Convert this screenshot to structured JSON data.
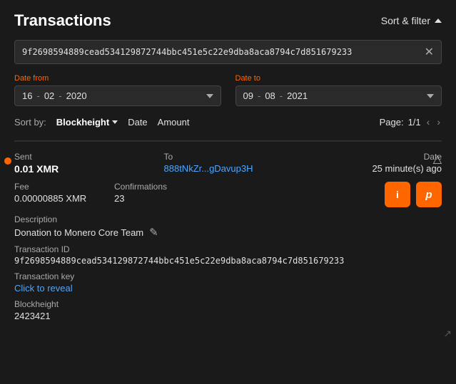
{
  "header": {
    "title": "Transactions",
    "sort_filter_label": "Sort & filter"
  },
  "search": {
    "value": "9f2698594889cead534129872744bbc451e5c22e9dba8aca8794c7d851679233"
  },
  "date_from": {
    "label": "Date from",
    "day": "16",
    "sep1": "-",
    "month": "02",
    "sep2": "-",
    "year": "2020"
  },
  "date_to": {
    "label": "Date to",
    "day": "09",
    "sep1": "-",
    "month": "08",
    "sep2": "-",
    "year": "2021"
  },
  "sort_row": {
    "label": "Sort by:",
    "blockheight": "Blockheight",
    "date": "Date",
    "amount": "Amount",
    "page_label": "Page:",
    "page_value": "1/1"
  },
  "transaction": {
    "sent_label": "Sent",
    "sent_amount": "0.01 XMR",
    "to_label": "To",
    "to_address": "888tNkZr...gDavup3H",
    "date_label": "Date",
    "date_value": "25 minute(s) ago",
    "fee_label": "Fee",
    "fee_value": "0.00000885 XMR",
    "confirmations_label": "Confirmations",
    "confirmations_value": "23",
    "description_label": "Description",
    "description_value": "Donation to Monero Core Team",
    "txid_label": "Transaction ID",
    "txid_value": "9f2698594889cead534129872744bbc451e5c22e9dba8aca8794c7d851679233",
    "txkey_label": "Transaction key",
    "txkey_value": "Click to reveal",
    "blockheight_label": "Blockheight",
    "blockheight_value": "2423421",
    "btn_info": "i",
    "btn_copy": "p"
  }
}
